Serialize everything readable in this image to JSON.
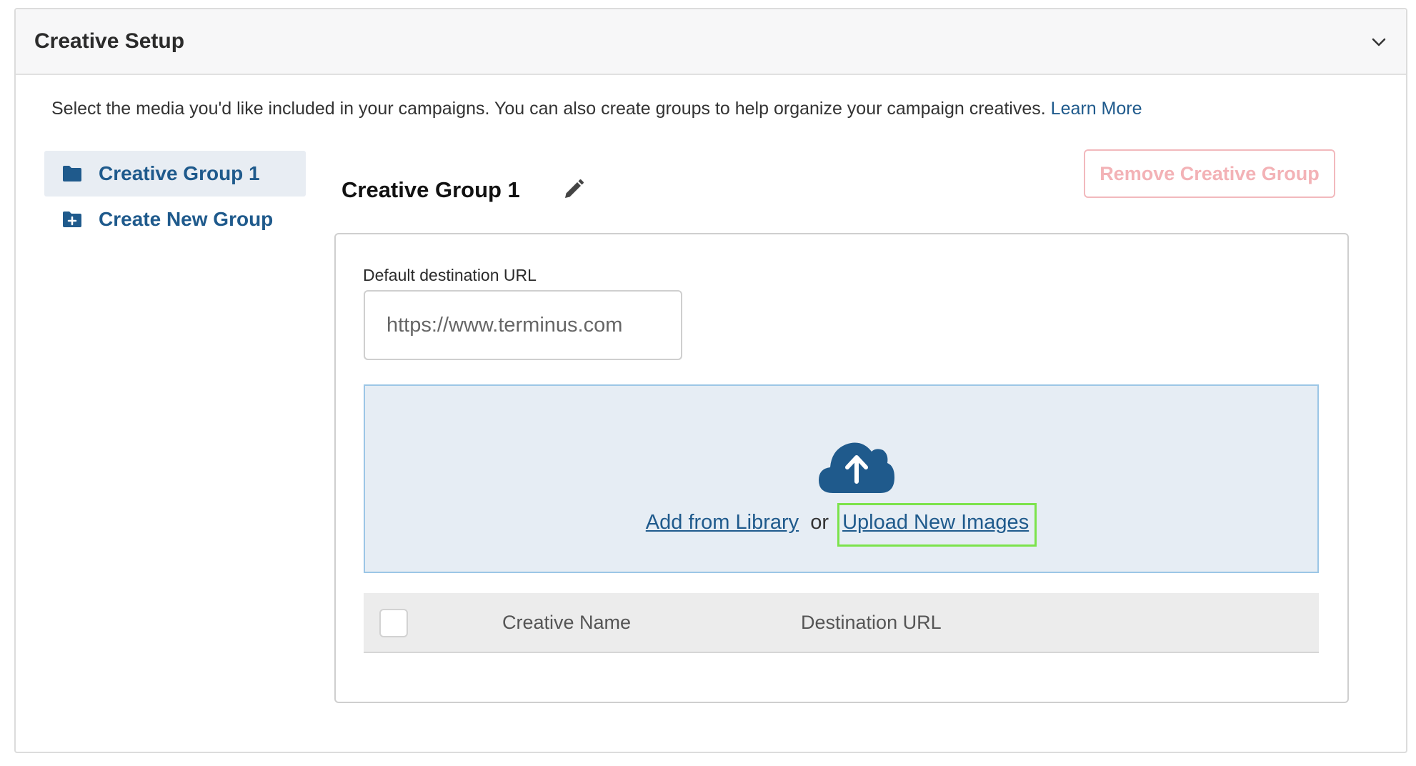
{
  "panel": {
    "title": "Creative Setup",
    "intro_text": "Select the media you'd like included in your campaigns. You can also create groups to help organize your campaign creatives.",
    "learn_more": "Learn More"
  },
  "sidebar": {
    "items": [
      {
        "label": "Creative Group 1",
        "icon": "folder-icon",
        "active": true
      },
      {
        "label": "Create New Group",
        "icon": "folder-plus-icon",
        "active": false
      }
    ]
  },
  "group": {
    "title": "Creative Group 1",
    "remove_label": "Remove Creative Group",
    "destination_label": "Default destination URL",
    "destination_placeholder": "https://www.terminus.com",
    "add_from_library": "Add from Library",
    "or_text": "or",
    "upload_new": "Upload New Images"
  },
  "table": {
    "columns": [
      "Creative Name",
      "Destination URL"
    ]
  },
  "colors": {
    "brand_blue": "#1f5a8c",
    "danger_light": "#f3b2b6",
    "dropzone_bg": "#e6edf4",
    "highlight": "#7ce34c"
  }
}
